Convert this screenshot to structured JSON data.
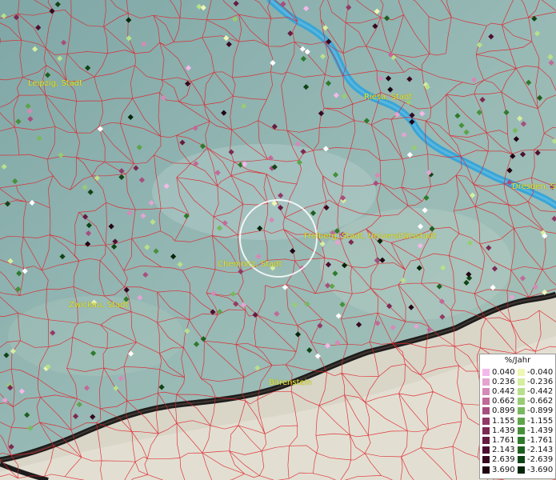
{
  "map": {
    "cities": [
      {
        "name": "Leipzig, Stadt"
      },
      {
        "name": "Riesa, Stadt"
      },
      {
        "name": "Dresden, Stadt"
      },
      {
        "name": "Freiberg, Stadt, Universitätsstadt"
      },
      {
        "name": "Chemnitz, Stadt"
      },
      {
        "name": "Zwickau, Stadt"
      },
      {
        "name": "Bärenstein"
      }
    ],
    "colors": {
      "border": "#e0222a",
      "river": "#3aa5d6",
      "label": "#e9e630",
      "terrain_base": "#8fb3b0",
      "mountains": "#d9d6c8",
      "ridge_line": "#1c1c1c"
    }
  },
  "legend": {
    "title": "%/Jahr",
    "positive": [
      {
        "label": "0.040",
        "color": "#f3b8ea"
      },
      {
        "label": "0.236",
        "color": "#e4a3d2"
      },
      {
        "label": "0.442",
        "color": "#d48ab8"
      },
      {
        "label": "0.662",
        "color": "#c06a98"
      },
      {
        "label": "0.899",
        "color": "#a84e7e"
      },
      {
        "label": "1.155",
        "color": "#923a66"
      },
      {
        "label": "1.439",
        "color": "#7c2a52"
      },
      {
        "label": "1.761",
        "color": "#661c40"
      },
      {
        "label": "2.143",
        "color": "#4e1030"
      },
      {
        "label": "2.639",
        "color": "#380820"
      },
      {
        "label": "3.690",
        "color": "#220312"
      }
    ],
    "negative": [
      {
        "label": "-0.040",
        "color": "#eef7b4"
      },
      {
        "label": "-0.236",
        "color": "#d6eea0"
      },
      {
        "label": "-0.442",
        "color": "#b8e08c"
      },
      {
        "label": "-0.662",
        "color": "#98cc74"
      },
      {
        "label": "-0.899",
        "color": "#78b85e"
      },
      {
        "label": "-1.155",
        "color": "#5ea44a"
      },
      {
        "label": "-1.439",
        "color": "#46903a"
      },
      {
        "label": "-1.761",
        "color": "#2f7a2c"
      },
      {
        "label": "-2.143",
        "color": "#1e6020"
      },
      {
        "label": "-2.639",
        "color": "#104416"
      },
      {
        "label": "-3.690",
        "color": "#06260a"
      }
    ]
  }
}
